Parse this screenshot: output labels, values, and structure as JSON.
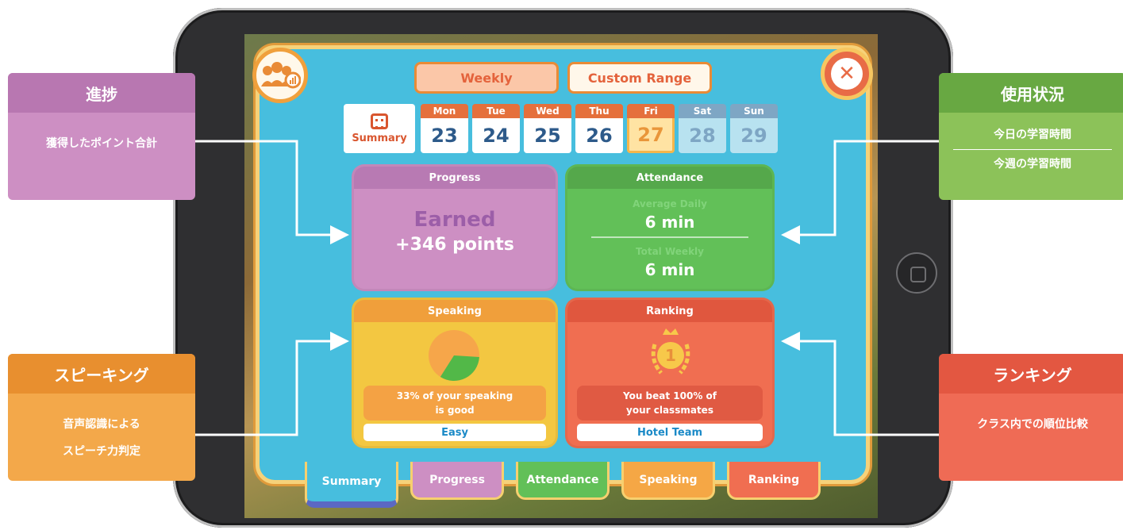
{
  "header": {
    "mode_weekly": "Weekly",
    "mode_custom": "Custom Range",
    "summary_label": "Summary"
  },
  "calendar": {
    "days": [
      {
        "name": "Mon",
        "date": "23"
      },
      {
        "name": "Tue",
        "date": "24"
      },
      {
        "name": "Wed",
        "date": "25"
      },
      {
        "name": "Thu",
        "date": "26"
      },
      {
        "name": "Fri",
        "date": "27"
      },
      {
        "name": "Sat",
        "date": "28"
      },
      {
        "name": "Sun",
        "date": "29"
      }
    ]
  },
  "cards": {
    "progress": {
      "title": "Progress",
      "label": "Earned",
      "value": "+346 points"
    },
    "attendance": {
      "title": "Attendance",
      "daily_label": "Average Daily",
      "daily_value": "6 min",
      "weekly_label": "Total Weekly",
      "weekly_value": "6 min"
    },
    "speaking": {
      "title": "Speaking",
      "message_1": "33% of your speaking",
      "message_2": "is good",
      "level": "Easy",
      "good_fraction": 0.33
    },
    "ranking": {
      "title": "Ranking",
      "rank": "1",
      "message_1": "You beat 100% of",
      "message_2": "your classmates",
      "team": "Hotel Team"
    }
  },
  "tabs": [
    "Summary",
    "Progress",
    "Attendance",
    "Speaking",
    "Ranking"
  ],
  "annotations": {
    "progress": {
      "title": "進捗",
      "desc": "獲得したポイント合計"
    },
    "usage": {
      "title": "使用状況",
      "desc_1": "今日の学習時間",
      "desc_2": "今週の学習時間"
    },
    "speaking": {
      "title": "スピーキング",
      "desc_1": "音声認識による",
      "desc_2": "スピーチ力判定"
    },
    "ranking": {
      "title": "ランキング",
      "desc": "クラス内での順位比較"
    }
  },
  "colors": {
    "panel": "#47bede",
    "progress": "#cd8fc3",
    "attendance": "#62c058",
    "speaking": "#f3c741",
    "ranking": "#f06e51"
  }
}
